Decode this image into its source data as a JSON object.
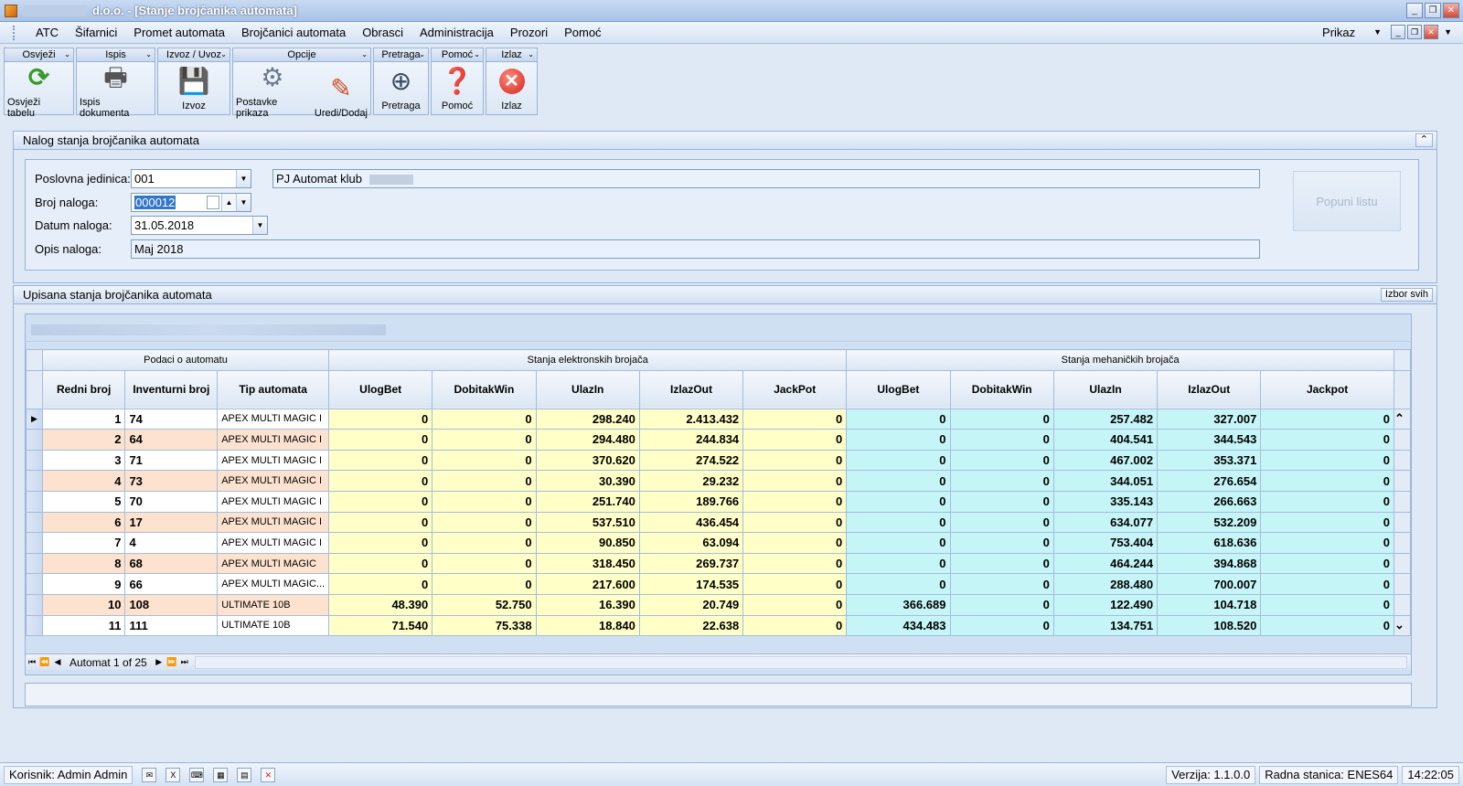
{
  "window": {
    "title": "d.o.o. - [Stanje brojčanika automata]"
  },
  "menu": {
    "items": [
      "ATC",
      "Šifarnici",
      "Promet automata",
      "Brojčanici automata",
      "Obrasci",
      "Administracija",
      "Prozori",
      "Pomoć"
    ],
    "right_label": "Prikaz"
  },
  "toolbar": {
    "groups": [
      {
        "header": "Osvježi",
        "buttons": [
          {
            "label": "Osvježi tabelu",
            "icon": "refresh-icon"
          }
        ]
      },
      {
        "header": "Ispis",
        "buttons": [
          {
            "label": "Ispis dokumenta",
            "icon": "print-icon"
          }
        ]
      },
      {
        "header": "Izvoz / Uvoz",
        "buttons": [
          {
            "label": "Izvoz",
            "icon": "save-icon"
          }
        ]
      },
      {
        "header": "Opcije",
        "buttons": [
          {
            "label": "Postavke prikaza",
            "icon": "gear-icon"
          },
          {
            "label": "Uredi/Dodaj",
            "icon": "pencil-icon"
          }
        ]
      },
      {
        "header": "Pretraga",
        "buttons": [
          {
            "label": "Pretraga",
            "icon": "binoculars-icon"
          }
        ]
      },
      {
        "header": "Pomoć",
        "buttons": [
          {
            "label": "Pomoć",
            "icon": "help-icon"
          }
        ]
      },
      {
        "header": "Izlaz",
        "buttons": [
          {
            "label": "Izlaz",
            "icon": "exit-icon"
          }
        ]
      }
    ]
  },
  "form": {
    "panel_title": "Nalog stanja brojčanika automata",
    "poslovna_label": "Poslovna jedinica:",
    "poslovna_value": "001",
    "poslovna_name": "PJ Automat klub",
    "broj_label": "Broj naloga:",
    "broj_value": "000012",
    "datum_label": "Datum naloga:",
    "datum_value": "31.05.2018",
    "opis_label": "Opis naloga:",
    "opis_value": "Maj 2018",
    "popuni_button": "Popuni listu"
  },
  "grid": {
    "panel_title": "Upisana stanja brojčanika automata",
    "select_all_button": "Izbor svih",
    "band_headers": [
      "Podaci o automatu",
      "Stanja elektronskih brojača",
      "Stanja mehaničkih brojača"
    ],
    "columns": [
      "Redni broj",
      "Inventurni broj",
      "Tip automata",
      "UlogBet",
      "DobitakWin",
      "UlazIn",
      "IzlazOut",
      "JackPot",
      "UlogBet",
      "DobitakWin",
      "UlazIn",
      "IzlazOut",
      "Jackpot"
    ],
    "rows": [
      [
        "1",
        "74",
        "APEX MULTI MAGIC I",
        "0",
        "0",
        "298.240",
        "2.413.432",
        "0",
        "0",
        "0",
        "257.482",
        "327.007",
        "0"
      ],
      [
        "2",
        "64",
        "APEX MULTI MAGIC I",
        "0",
        "0",
        "294.480",
        "244.834",
        "0",
        "0",
        "0",
        "404.541",
        "344.543",
        "0"
      ],
      [
        "3",
        "71",
        "APEX MULTI MAGIC I",
        "0",
        "0",
        "370.620",
        "274.522",
        "0",
        "0",
        "0",
        "467.002",
        "353.371",
        "0"
      ],
      [
        "4",
        "73",
        "APEX MULTI MAGIC I",
        "0",
        "0",
        "30.390",
        "29.232",
        "0",
        "0",
        "0",
        "344.051",
        "276.654",
        "0"
      ],
      [
        "5",
        "70",
        "APEX MULTI MAGIC I",
        "0",
        "0",
        "251.740",
        "189.766",
        "0",
        "0",
        "0",
        "335.143",
        "266.663",
        "0"
      ],
      [
        "6",
        "17",
        "APEX MULTI MAGIC I",
        "0",
        "0",
        "537.510",
        "436.454",
        "0",
        "0",
        "0",
        "634.077",
        "532.209",
        "0"
      ],
      [
        "7",
        "4",
        "APEX MULTI MAGIC I",
        "0",
        "0",
        "90.850",
        "63.094",
        "0",
        "0",
        "0",
        "753.404",
        "618.636",
        "0"
      ],
      [
        "8",
        "68",
        "APEX MULTI MAGIC",
        "0",
        "0",
        "318.450",
        "269.737",
        "0",
        "0",
        "0",
        "464.244",
        "394.868",
        "0"
      ],
      [
        "9",
        "66",
        "APEX MULTI  MAGIC...",
        "0",
        "0",
        "217.600",
        "174.535",
        "0",
        "0",
        "0",
        "288.480",
        "700.007",
        "0"
      ],
      [
        "10",
        "108",
        "ULTIMATE 10B",
        "48.390",
        "52.750",
        "16.390",
        "20.749",
        "0",
        "366.689",
        "0",
        "122.490",
        "104.718",
        "0"
      ],
      [
        "11",
        "111",
        "ULTIMATE 10B",
        "71.540",
        "75.338",
        "18.840",
        "22.638",
        "0",
        "434.483",
        "0",
        "134.751",
        "108.520",
        "0"
      ]
    ],
    "navigator_text": "Automat 1 of 25"
  },
  "status": {
    "user": "Korisnik: Admin Admin",
    "version": "Verzija: 1.1.0.0",
    "station": "Radna stanica: ENES64",
    "time": "14:22:05"
  }
}
